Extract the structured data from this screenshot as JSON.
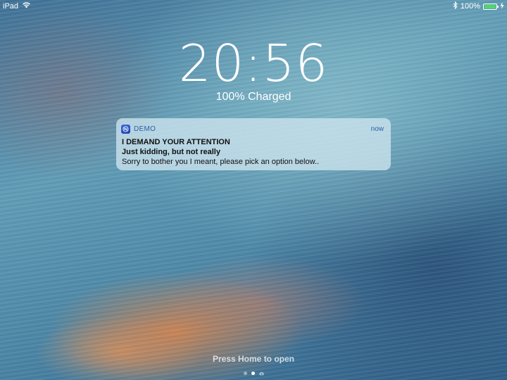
{
  "status_bar": {
    "device": "iPad",
    "battery_percent_text": "100%",
    "battery_level": 1.0,
    "battery_color": "#4cd964"
  },
  "lock_screen": {
    "time": "20:56",
    "charge_status": "100% Charged",
    "unlock_hint": "Press Home to open",
    "page_count": 3,
    "active_page": 2
  },
  "notification": {
    "app_name": "DEMO",
    "time": "now",
    "title": "I DEMAND YOUR ATTENTION",
    "subtitle": "Just kidding, but not really",
    "body": "Sorry to bother you I meant, please pick an option below..",
    "accent_color": "#2e5ea8",
    "icon": "app-icon"
  },
  "icons": {
    "wifi": "wifi-icon",
    "bluetooth": "bluetooth-icon",
    "battery": "battery-icon",
    "charging": "charging-bolt-icon",
    "camera": "camera-icon"
  }
}
